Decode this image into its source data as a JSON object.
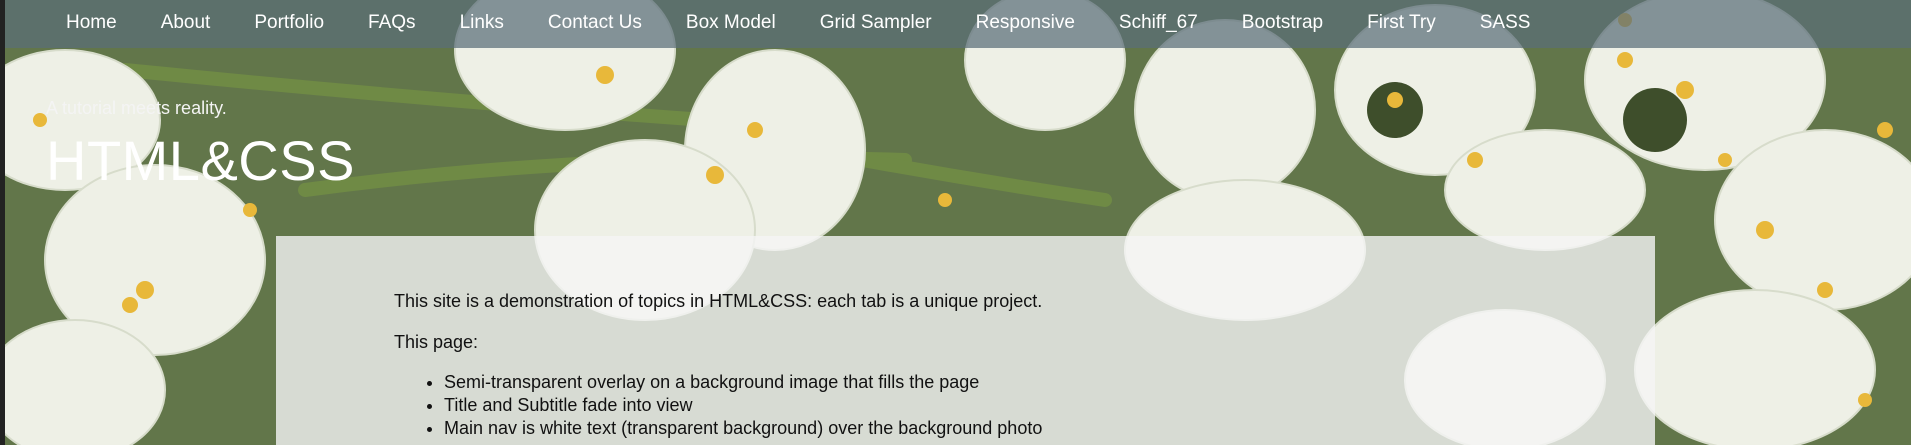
{
  "nav": {
    "items": [
      {
        "label": "Home"
      },
      {
        "label": "About"
      },
      {
        "label": "Portfolio"
      },
      {
        "label": "FAQs"
      },
      {
        "label": "Links"
      },
      {
        "label": "Contact Us"
      },
      {
        "label": "Box Model"
      },
      {
        "label": "Grid Sampler"
      },
      {
        "label": "Responsive"
      },
      {
        "label": "Schiff_67"
      },
      {
        "label": "Bootstrap"
      },
      {
        "label": "First Try"
      },
      {
        "label": "SASS"
      }
    ]
  },
  "header": {
    "subtitle": "A tutorial meets reality.",
    "title": "HTML&CSS"
  },
  "main": {
    "intro": "This site is a demonstration of topics in HTML&CSS: each tab is a unique project.",
    "page_label": "This page:",
    "bullets": [
      "Semi-transparent overlay on a background image that fills the page",
      "Title and Subtitle fade into view",
      "Main nav is white text (transparent background) over the background photo"
    ]
  },
  "colors": {
    "nav_bar": "#5a6e78",
    "overlay": "#f5f5f5",
    "title_text": "#ffffff"
  }
}
